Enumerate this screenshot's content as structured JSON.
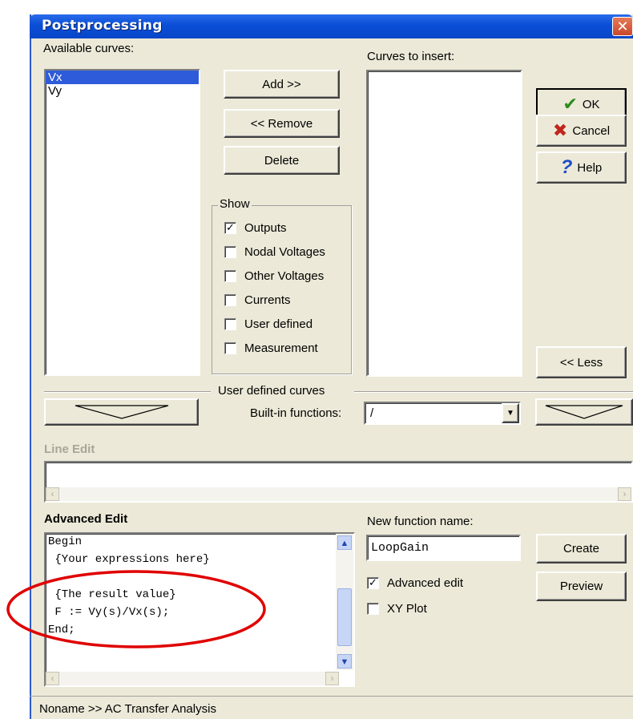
{
  "window": {
    "title": "Postprocessing",
    "close_glyph": "✕"
  },
  "available": {
    "label": "Available curves:",
    "items": [
      "Vx",
      "Vy"
    ],
    "selected_index": 0
  },
  "insert": {
    "label": "Curves to insert:"
  },
  "buttons": {
    "add": "Add >>",
    "remove": "<< Remove",
    "delete": "Delete",
    "ok": "OK",
    "cancel": "Cancel",
    "help": "Help",
    "less": "<< Less",
    "create": "Create",
    "preview": "Preview"
  },
  "show": {
    "label": "Show",
    "options": [
      {
        "label": "Outputs",
        "checked": true
      },
      {
        "label": "Nodal Voltages",
        "checked": false
      },
      {
        "label": "Other Voltages",
        "checked": false
      },
      {
        "label": "Currents",
        "checked": false
      },
      {
        "label": "User defined",
        "checked": false
      },
      {
        "label": "Measurement",
        "checked": false
      }
    ]
  },
  "user_defined": {
    "label": "User defined curves",
    "builtin_label": "Built-in functions:",
    "builtin_value": "/"
  },
  "line_edit": {
    "label": "Line Edit",
    "value": ""
  },
  "advanced": {
    "label": "Advanced Edit",
    "code_lines": [
      "Begin",
      " {Your expressions here}",
      "",
      " {The result value}",
      " F := Vy(s)/Vx(s);",
      "End;"
    ]
  },
  "new_function": {
    "label": "New function name:",
    "value": "LoopGain"
  },
  "options": {
    "advanced_edit": {
      "label": "Advanced edit",
      "checked": true
    },
    "xy_plot": {
      "label": "XY Plot",
      "checked": false
    }
  },
  "status": {
    "text": "Noname >> AC Transfer Analysis"
  },
  "colors": {
    "annotation_circle": "#E00000",
    "selection": "#2E5BD9",
    "ok_check": "#2E8B1E",
    "cancel_x": "#C0241B",
    "help_q": "#1F4FC8"
  },
  "icons": {
    "ok": "checkmark-icon",
    "cancel": "x-icon",
    "help": "question-icon"
  }
}
